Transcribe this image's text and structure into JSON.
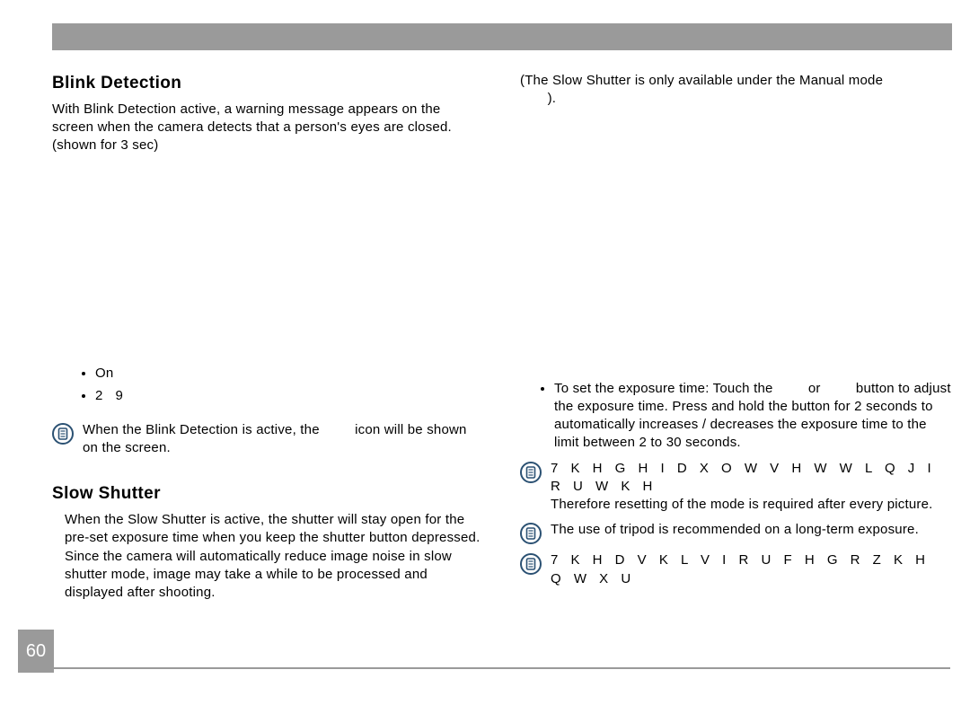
{
  "page_number": "60",
  "left": {
    "blink": {
      "title": "Blink Detection",
      "paragraph": "With Blink Detection active, a warning message appears on the screen when the camera detects that a person's eyes are closed.(shown for 3 sec)",
      "bullets": [
        "On",
        "2 9"
      ],
      "note_prefix": "When the Blink Detection is active, the ",
      "note_suffix": " icon will be shown on the screen."
    },
    "slow": {
      "title": "Slow Shutter",
      "paragraph": "When the Slow Shutter is active, the shutter will stay open for the pre-set exposure time when you keep the shutter button depressed. Since the camera will automatically reduce image noise in slow shutter mode, image may take a while to be processed and displayed after shooting."
    }
  },
  "right": {
    "top_line_a": "(The Slow Shutter is only available under the Manual mode",
    "top_line_b": ").",
    "instr_prefix": "To set the exposure time: Touch the ",
    "instr_mid": " or ",
    "instr_after": " button to adjust the exposure time. Press and hold the button for 2 seconds to automatically increases / decreases the exposure time to the limit between 2 to 30 seconds.",
    "note1_garbled": "7 K H   G H I D X O W   V H W W L Q J   I R U   W K H",
    "note1_rest": "Therefore resetting of the mode is required after every picture.",
    "note2": "The use of tripod is recommended on a long-term exposure.",
    "note3_garbled": "7 K H    D V K   L V   I R U F H G   R    Z K H Q   W X U"
  },
  "icons": {
    "note": "note-icon"
  }
}
